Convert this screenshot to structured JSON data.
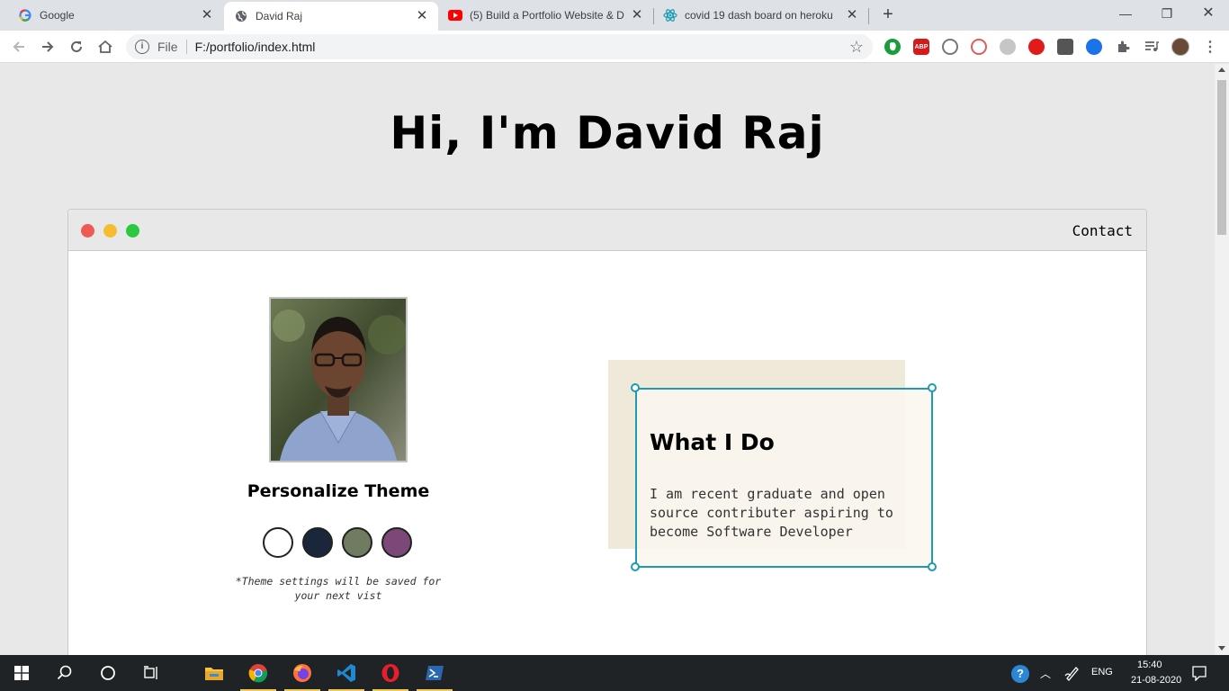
{
  "browser": {
    "tabs": [
      {
        "title": "Google",
        "icon": "google-icon",
        "active": false
      },
      {
        "title": "David Raj",
        "icon": "globe-icon",
        "active": true
      },
      {
        "title": "(5) Build a Portfolio Website & D",
        "icon": "youtube-icon",
        "active": false
      },
      {
        "title": "covid 19 dash board on heroku",
        "icon": "react-icon",
        "active": false
      }
    ],
    "address": {
      "scheme": "File",
      "url": "F:/portfolio/index.html"
    },
    "extensions": [
      "evernote-icon",
      "adblock-plus-icon",
      "extension-icon",
      "extension-icon",
      "extension-icon",
      "extension-icon",
      "extension-icon",
      "extension-icon",
      "extensions-puzzle-icon",
      "media-control-icon",
      "profile-avatar"
    ],
    "abp_label": "ABP"
  },
  "page": {
    "hero_title": "Hi, I'm David Raj",
    "window": {
      "contact_label": "Contact",
      "dots": [
        "#ee5b54",
        "#f5bd2f",
        "#2bc840"
      ]
    },
    "profile": {
      "theme_title": "Personalize Theme",
      "theme_swatches": [
        {
          "name": "light",
          "color": "#ffffff"
        },
        {
          "name": "blue",
          "color": "#1a2639"
        },
        {
          "name": "green",
          "color": "#6f7c5f"
        },
        {
          "name": "purple",
          "color": "#7b4877"
        }
      ],
      "theme_note": "*Theme settings will be saved for your next vist"
    },
    "intro_card": {
      "title": "What I Do",
      "text": "I am recent graduate and open source contributer aspiring to become Software Developer"
    }
  },
  "taskbar": {
    "apps": [
      "windows-start-icon",
      "search-icon",
      "cortana-icon",
      "task-view-icon",
      "file-explorer-icon",
      "chrome-icon",
      "firefox-icon",
      "vscode-icon",
      "opera-icon",
      "powershell-icon"
    ],
    "language": "ENG",
    "time": "15:40",
    "date": "21-08-2020"
  }
}
